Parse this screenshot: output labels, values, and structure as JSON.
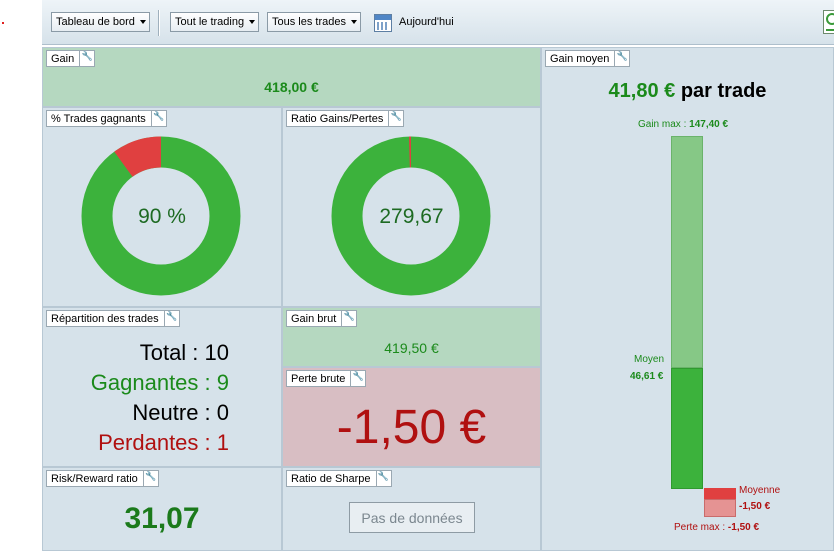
{
  "toolbar": {
    "dashboard_label": "Tableau de bord",
    "trading_label": "Tout le trading",
    "trades_label": "Tous les trades",
    "today_label": "Aujourd'hui"
  },
  "panels": {
    "gain": {
      "title": "Gain",
      "value": "418,00 €"
    },
    "win_pct": {
      "title": "% Trades gagnants",
      "value": "90 %",
      "fraction": 0.9
    },
    "ratio_gp": {
      "title": "Ratio Gains/Pertes",
      "value": "279,67",
      "fraction": 0.996
    },
    "repartition": {
      "title": "Répartition des trades",
      "total": "Total : 10",
      "gagnantes": "Gagnantes : 9",
      "neutre": "Neutre : 0",
      "perdantes": "Perdantes : 1"
    },
    "gain_brut": {
      "title": "Gain brut",
      "value": "419,50 €"
    },
    "perte_brute": {
      "title": "Perte brute",
      "value": "-1,50 €"
    },
    "risk_reward": {
      "title": "Risk/Reward ratio",
      "value": "31,07"
    },
    "sharpe": {
      "title": "Ratio de Sharpe",
      "button": "Pas de données"
    },
    "gain_moyen": {
      "title": "Gain moyen",
      "value": "41,80 €",
      "suffix": "par trade",
      "gain_max_label": "Gain max :",
      "gain_max_value": "147,40 €",
      "moyen_label": "Moyen",
      "moyen_value": "46,61 €",
      "moyenne_label": "Moyenne",
      "moyenne_value": "-1,50 €",
      "perte_max_label": "Perte max :",
      "perte_max_value": "-1,50 €"
    }
  },
  "colors": {
    "green": "#3cb23c",
    "light_green": "#86c886",
    "red": "#e04040",
    "dark_red": "#b01010",
    "text_green": "#1b8a1b"
  },
  "icons": [
    "wrench-icon",
    "calendar-icon",
    "chevron-down-icon",
    "chart-icon"
  ]
}
